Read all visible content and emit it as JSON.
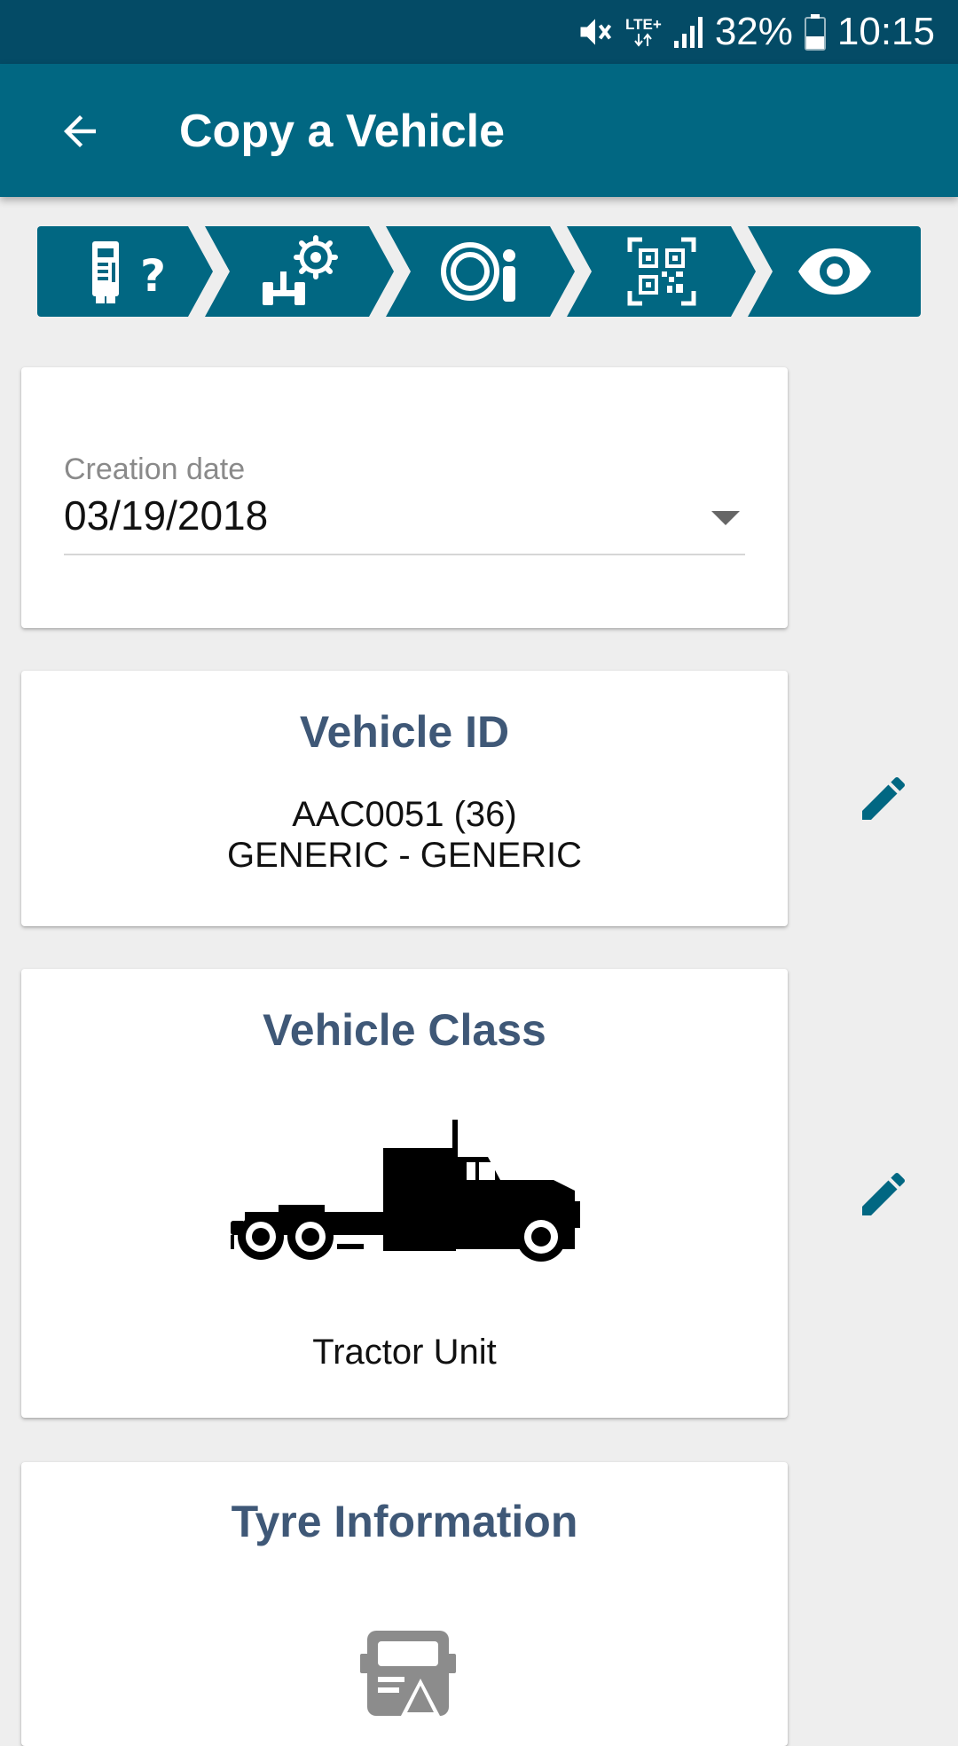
{
  "status_bar": {
    "network": "LTE+",
    "battery": "32%",
    "time": "10:15",
    "icons": [
      "mute-icon",
      "lte-icon",
      "signal-icon",
      "battery-icon"
    ]
  },
  "app_bar": {
    "title": "Copy a Vehicle",
    "back_icon": "arrow-left-icon"
  },
  "stepper": {
    "steps": [
      {
        "icon": "truck-question-icon",
        "active": true
      },
      {
        "icon": "axle-gear-icon",
        "active": false
      },
      {
        "icon": "tyre-info-icon",
        "active": false
      },
      {
        "icon": "qr-code-icon",
        "active": false
      },
      {
        "icon": "eye-icon",
        "active": false
      }
    ]
  },
  "creation_date": {
    "label": "Creation date",
    "value": "03/19/2018"
  },
  "vehicle_id": {
    "title": "Vehicle ID",
    "line1": "AAC0051 (36)",
    "line2": "GENERIC - GENERIC"
  },
  "vehicle_class": {
    "title": "Vehicle Class",
    "name": "Tractor Unit",
    "icon": "tractor-unit-icon"
  },
  "tyre_information": {
    "title": "Tyre Information",
    "icon": "truck-warning-icon"
  },
  "colors": {
    "status_bar": "#044b66",
    "primary": "#016782",
    "card_title": "#3f5877",
    "background": "#eeeeee"
  }
}
